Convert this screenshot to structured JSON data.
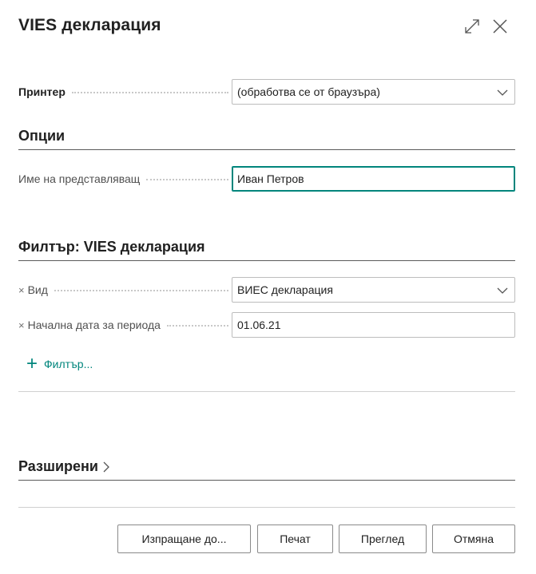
{
  "dialog": {
    "title": "VIES декларация"
  },
  "printer": {
    "label": "Принтер",
    "value": "(обработва се от браузъра)"
  },
  "options": {
    "heading": "Опции",
    "presenter_label": "Име на представляващ",
    "presenter_value": "Иван Петров"
  },
  "filter": {
    "heading": "Филтър: VIES декларация",
    "type_label": "Вид",
    "type_value": "ВИЕС декларация",
    "start_date_label": "Начална дата за периода",
    "start_date_value": "01.06.21",
    "add_filter_label": "Филтър..."
  },
  "advanced": {
    "label": "Разширени"
  },
  "buttons": {
    "send_to": "Изпращане до...",
    "print": "Печат",
    "preview": "Преглед",
    "cancel": "Отмяна"
  },
  "colors": {
    "accent": "#00857c",
    "text": "#212121",
    "muted": "#505050"
  }
}
